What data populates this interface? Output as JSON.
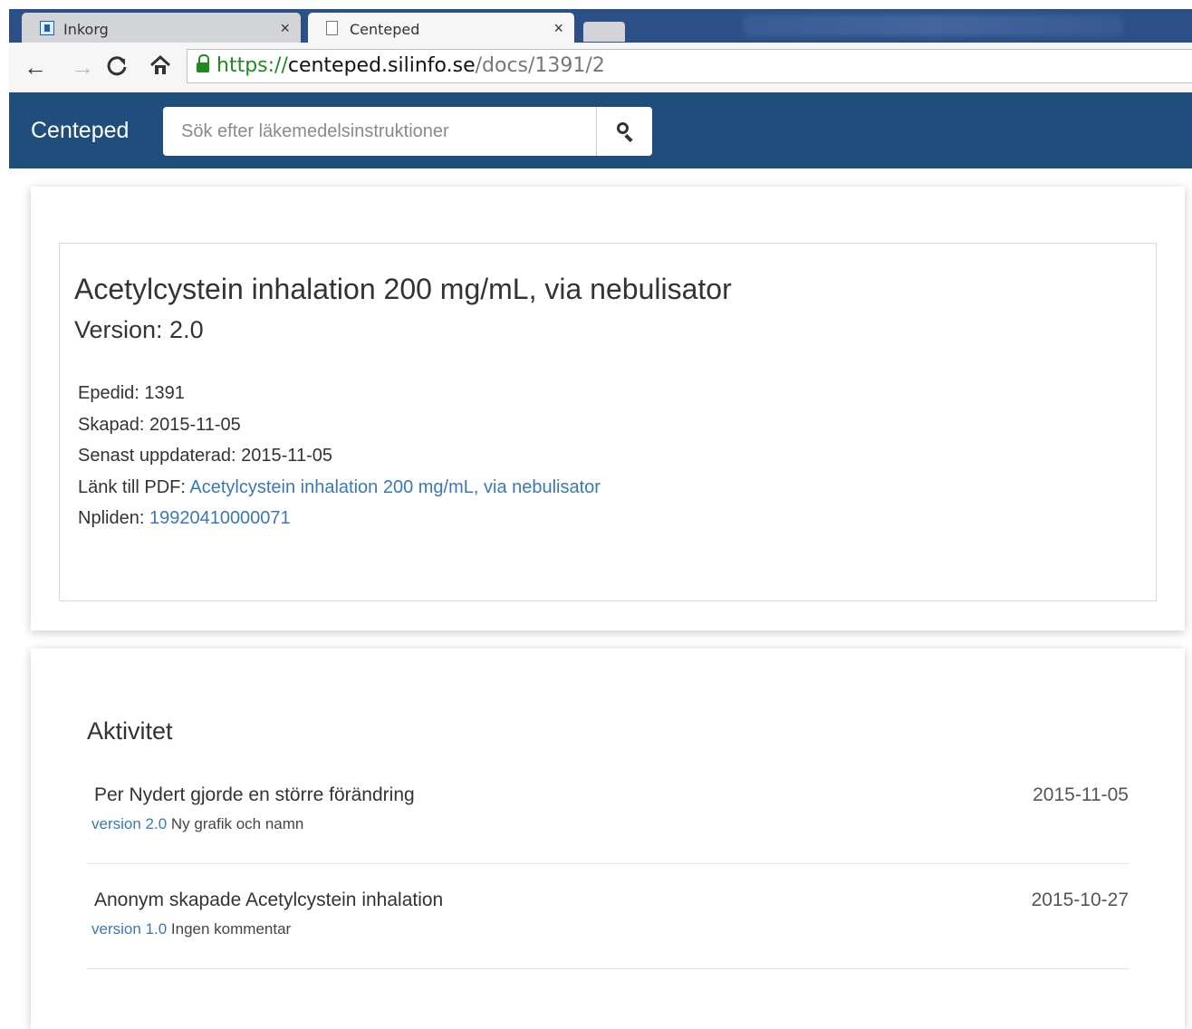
{
  "browser": {
    "tabs": [
      {
        "title": "Inkorg",
        "icon": "outlook-icon"
      },
      {
        "title": "Centeped",
        "icon": "document-icon"
      }
    ],
    "close_glyph": "×",
    "url": {
      "scheme": "https://",
      "host": "centeped.silinfo.se",
      "path": "/docs/1391/2"
    }
  },
  "navbar": {
    "brand": "Centeped",
    "search_placeholder": "Sök efter läkemedelsinstruktioner"
  },
  "document": {
    "title": "Acetylcystein inhalation 200 mg/mL, via nebulisator",
    "version": "Version: 2.0",
    "epedid_label": "Epedid:",
    "epedid": "1391",
    "created_label": "Skapad:",
    "created": "2015-11-05",
    "updated_label": "Senast uppdaterad:",
    "updated": "2015-11-05",
    "pdf_label": "Länk till PDF:",
    "pdf_link": "Acetylcystein inhalation 200 mg/mL, via nebulisator",
    "npl_label": "Npliden:",
    "npl_id": "19920410000071"
  },
  "activity": {
    "heading": "Aktivitet",
    "items": [
      {
        "description": "Per Nydert gjorde en större förändring",
        "date": "2015-11-05",
        "version_link": "version 2.0",
        "comment": "Ny grafik och namn"
      },
      {
        "description": "Anonym skapade Acetylcystein inhalation",
        "date": "2015-10-27",
        "version_link": "version 1.0",
        "comment": "Ingen kommentar"
      }
    ]
  },
  "colors": {
    "navbar": "#1f4e7d",
    "link": "#3a78b5",
    "tabbar": "#2c4f86"
  }
}
